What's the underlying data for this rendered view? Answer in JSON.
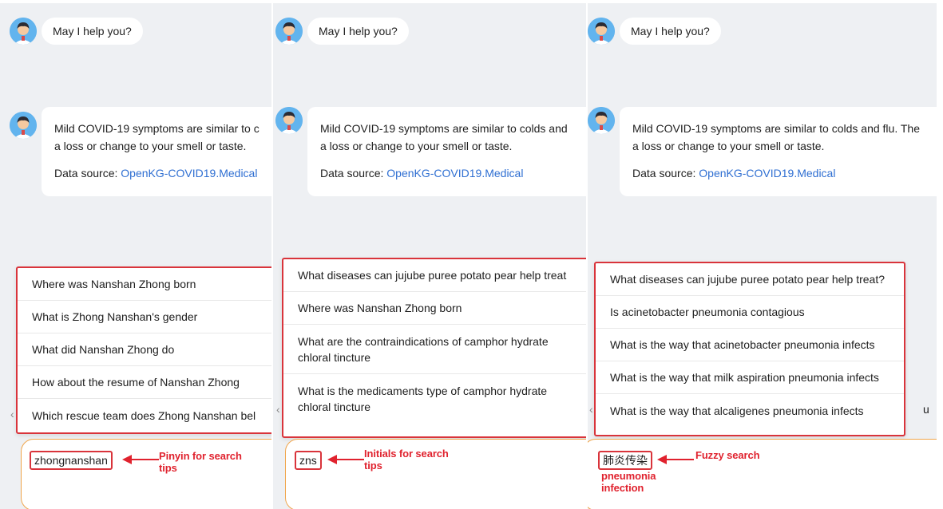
{
  "panels": [
    {
      "greeting": "May I help you?",
      "answer_text_line1": "Mild COVID-19 symptoms are similar to c",
      "answer_text_line2": "a loss or change to your smell or taste.",
      "data_source_label": "Data source: ",
      "data_source_link": "OpenKG-COVID19.Medical",
      "suggestions": [
        "Where was Nanshan Zhong born",
        "What is Zhong Nanshan's gender",
        "What did Nanshan Zhong do",
        "How about the resume of Nanshan Zhong",
        "Which rescue team does Zhong Nanshan bel"
      ],
      "query": "zhongnanshan",
      "annotation_line1": "Pinyin for search",
      "annotation_line2": "tips"
    },
    {
      "greeting": "May I help you?",
      "answer_text_line1": "Mild COVID-19 symptoms are similar to colds and",
      "answer_text_line2": "a loss or change to your smell or taste.",
      "data_source_label": "Data source: ",
      "data_source_link": "OpenKG-COVID19.Medical",
      "suggestions": [
        "What diseases can jujube puree potato pear help treat",
        "Where was Nanshan Zhong born",
        "What are the contraindications of camphor hydrate chloral tincture",
        "What is the medicaments type of camphor hydrate chloral tincture"
      ],
      "query": "zns",
      "annotation_line1": "Initials for search",
      "annotation_line2": "tips"
    },
    {
      "greeting": "May I help you?",
      "answer_text_line1": "Mild COVID-19 symptoms are similar to colds and flu. The",
      "answer_text_line2": "a loss or change to your smell or taste.",
      "data_source_label": "Data source: ",
      "data_source_link": "OpenKG-COVID19.Medical",
      "suggestions": [
        "What diseases can jujube puree potato pear help treat?",
        "Is acinetobacter pneumonia contagious",
        "What is the way that acinetobacter pneumonia infects",
        "What is the way that milk aspiration pneumonia infects",
        "What is the way that alcaligenes pneumonia infects"
      ],
      "query": "肺炎传染",
      "annotation_line1": "Fuzzy search",
      "translation_line1": "pneumonia",
      "translation_line2": "infection",
      "edge_text": "u"
    }
  ],
  "icons": {
    "avatar": "doctor-avatar-icon",
    "scroll": "chevron-left-icon"
  },
  "colors": {
    "panel_bg": "#eef0f3",
    "highlight_red": "#d9343b",
    "link_blue": "#2f6fd2",
    "input_border": "#f0a54a"
  }
}
